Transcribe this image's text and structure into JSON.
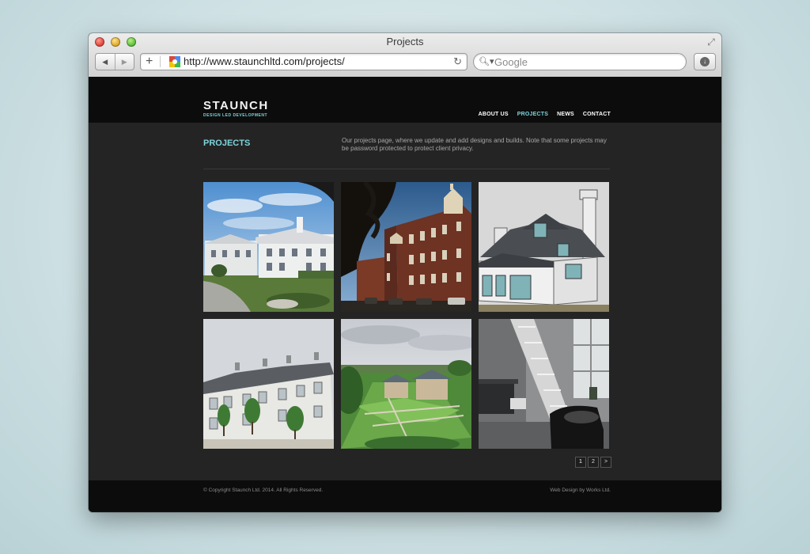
{
  "browser": {
    "window_title": "Projects",
    "url": "http://www.staunchltd.com/projects/",
    "search_placeholder": "Google",
    "back_glyph": "◀",
    "forward_glyph": "▶",
    "plus_glyph": "+",
    "reload_glyph": "↻",
    "search_glyph": "🔍︎▾"
  },
  "site": {
    "logo": "STAUNCH",
    "tagline": "DESIGN LED DEVELOPMENT",
    "nav": [
      {
        "label": "ABOUT US",
        "active": false
      },
      {
        "label": "PROJECTS",
        "active": true
      },
      {
        "label": "NEWS",
        "active": false
      },
      {
        "label": "CONTACT",
        "active": false
      }
    ],
    "page_heading": "PROJECTS",
    "intro": "Our projects page, where we update and add designs and builds. Note that some projects may be password protected to protect client privacy.",
    "pagination": {
      "pages": [
        "1",
        "2"
      ],
      "current": "1",
      "next_glyph": ">"
    },
    "footer": {
      "copyright": "© Copyright Staunch Ltd. 2014. All Rights Reserved.",
      "credit": "Web Design by Works Ltd."
    }
  },
  "colors": {
    "accent": "#7ed4dc",
    "header_bg": "#0c0c0c",
    "page_bg": "#242424"
  }
}
